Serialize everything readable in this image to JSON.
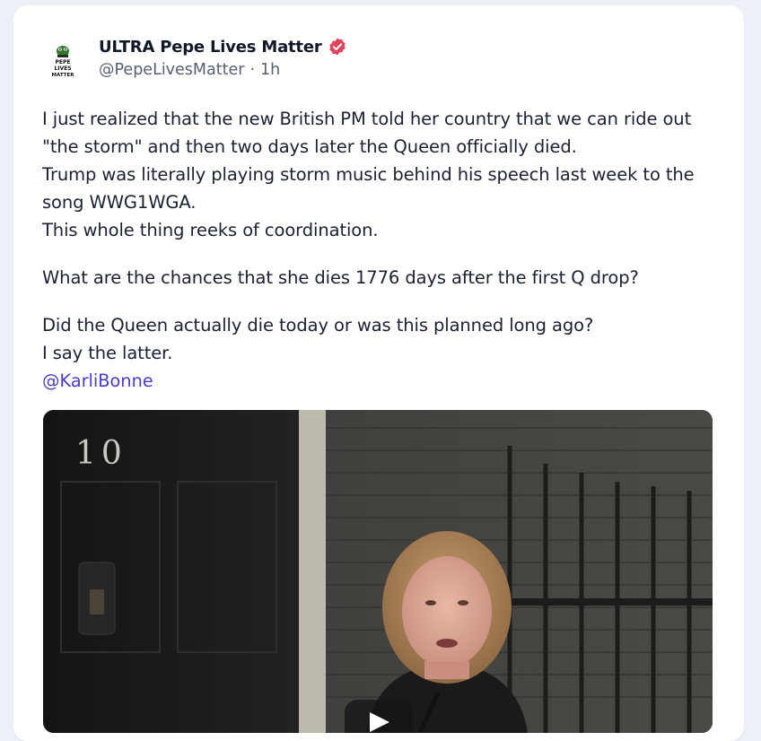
{
  "post": {
    "author": {
      "display_name": "ULTRA Pepe Lives Matter",
      "handle": "@PepeLivesMatter",
      "separator": "·",
      "time_ago": "1h",
      "avatar_text": [
        "PEPE",
        "LIVES",
        "MATTER"
      ],
      "verified_icon": "verified-badge-icon",
      "verified_color": "#e0455e"
    },
    "paragraphs": [
      [
        "I just realized that the new British PM told her country that we can ride out \"the storm\" and then two days later the Queen officially died.",
        "Trump was literally playing storm music behind his speech last week to the song WWG1WGA.",
        "This whole thing reeks of coordination."
      ],
      [
        "What are the chances that she dies 1776 days after the first Q drop?"
      ],
      [
        "Did the Queen actually die today or was this planned long ago?",
        "I say the latter."
      ]
    ],
    "mention": "@KarliBonne",
    "mention_color": "#4a3fc0",
    "video": {
      "door_number": "10",
      "play_icon": "play-icon"
    }
  }
}
